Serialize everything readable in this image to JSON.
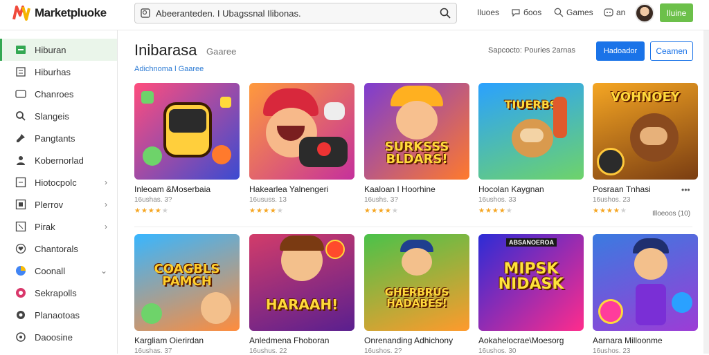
{
  "app": {
    "name": "Marketpluoke"
  },
  "search": {
    "value": "Abeeranteden. I Ubagssnal Ilibonas."
  },
  "top_links": [
    {
      "label": "Iluoes",
      "icon": "none"
    },
    {
      "label": "бoos",
      "icon": "chat-icon"
    },
    {
      "label": "Games",
      "icon": "search-icon"
    },
    {
      "label": "an",
      "icon": "controller-icon"
    }
  ],
  "top_button": "Iluine",
  "sidebar": {
    "items": [
      {
        "label": "Hiburan",
        "icon": "hiburan-icon",
        "active": true
      },
      {
        "label": "Hiburhas",
        "icon": "list-icon"
      },
      {
        "label": "Chanroes",
        "icon": "grid-icon"
      },
      {
        "label": "Slangeis",
        "icon": "search-icon"
      },
      {
        "label": "Pangtants",
        "icon": "pin-icon"
      },
      {
        "label": "Kobernorlad",
        "icon": "person-icon"
      },
      {
        "label": "Hiotocpolc",
        "icon": "grid-icon",
        "chevron": "›"
      },
      {
        "label": "Plerrov",
        "icon": "square-icon",
        "chevron": "›"
      },
      {
        "label": "Pirak",
        "icon": "square-icon",
        "chevron": "›"
      },
      {
        "label": "Chantorals",
        "icon": "heart-icon"
      },
      {
        "label": "Coonall",
        "icon": "circle-icon",
        "chevron": "⌄"
      },
      {
        "label": "Sekrapolls",
        "icon": "gear-icon"
      },
      {
        "label": "Planaotoas",
        "icon": "dot-icon"
      },
      {
        "label": "Daoosine",
        "icon": "dot-icon"
      }
    ]
  },
  "main": {
    "title": "Inibarasa",
    "subtitle": "Gaaree",
    "breadcrumb": "Adichnoma l Gaaree",
    "sort_label": "Sapcocto: Pouries 2arnas",
    "primary_button": "Hadoador",
    "secondary_button": "Ceamen"
  },
  "cards": [
    {
      "title": "Inleoam &Moserbaia",
      "meta": "16ushas. 3?",
      "rating": 4,
      "art_text": "",
      "palette": [
        "#ff4d7d",
        "#3b4bd1"
      ]
    },
    {
      "title": "Hakearlea Yalnengeri",
      "meta": "16ususs. 13",
      "rating": 4,
      "art_text": "",
      "palette": [
        "#ff9a3c",
        "#c5309c"
      ]
    },
    {
      "title": "Kaaloan I Hoorhine",
      "meta": "16ushs. 3?",
      "rating": 4,
      "art_text": "SURKSSS BLDARS!",
      "palette": [
        "#7d3cd1",
        "#ff7a2c"
      ]
    },
    {
      "title": "Hocolan Kaygnan",
      "meta": "16ushos. 33",
      "rating": 4,
      "art_text": "TIUERBS",
      "palette": [
        "#2aa1ff",
        "#6ed36a"
      ]
    },
    {
      "title": "Posraan Tnhasi",
      "meta": "16ushos. 23",
      "rating": 4,
      "art_text": "VOHNOEY",
      "palette": [
        "#f5a623",
        "#7a3d12"
      ],
      "more": "•••",
      "extra": "Illoeoos (10)"
    },
    {
      "title": "Kargliam Oierirdan",
      "meta": "16ushas. 37",
      "rating": 4,
      "art_text": "COAGBLS PAMCH",
      "palette": [
        "#ff8c3c",
        "#38b6ff"
      ]
    },
    {
      "title": "Anledmena Fhoboran",
      "meta": "16ushus. 22",
      "rating": 4,
      "art_text": "HARAAH!",
      "palette": [
        "#d23c6a",
        "#5a1f8f"
      ]
    },
    {
      "title": "Onrenanding Adhichony",
      "meta": "16ushos. 2?",
      "rating": 4,
      "art_text": "GHERBRUS HADABES!",
      "palette": [
        "#4ac24a",
        "#ff9a2c"
      ]
    },
    {
      "title": "Aokahelocrae\\Moesorg",
      "meta": "16ushos. 30",
      "rating": 4,
      "art_text": "MIPSK NIDASK",
      "palette": [
        "#2c2cd6",
        "#ff2c8c"
      ],
      "banner": "ABSANOEROA"
    },
    {
      "title": "Aarnara Milloonme",
      "meta": "16ushos. 23",
      "rating": 4,
      "art_text": "",
      "palette": [
        "#3a7be0",
        "#9c3cd6"
      ]
    }
  ],
  "colors": {
    "accent": "#1a73e8",
    "active": "#34a853",
    "star": "#f5a623",
    "green_button": "#6cc04a"
  }
}
